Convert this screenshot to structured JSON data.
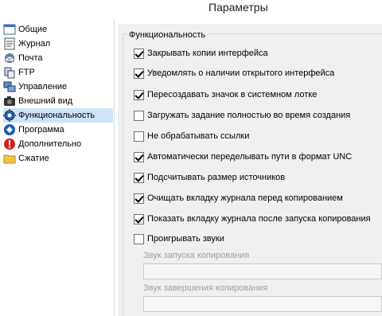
{
  "window": {
    "title": "Параметры"
  },
  "sidebar": {
    "items": [
      {
        "label": "Общие",
        "icon": "window-icon"
      },
      {
        "label": "Журнал",
        "icon": "log-icon"
      },
      {
        "label": "Почта",
        "icon": "mail-icon"
      },
      {
        "label": "FTP",
        "icon": "ftp-icon"
      },
      {
        "label": "Управление",
        "icon": "network-icon"
      },
      {
        "label": "Внешний вид",
        "icon": "camera-icon"
      },
      {
        "label": "Функциональность",
        "icon": "gear-icon",
        "selected": true
      },
      {
        "label": "Программа",
        "icon": "app-icon"
      },
      {
        "label": "Дополнительно",
        "icon": "warning-icon"
      },
      {
        "label": "Сжатие",
        "icon": "folder-icon"
      }
    ]
  },
  "panel": {
    "group_title": "Функциональность",
    "options": [
      {
        "label": "Закрывать копии интерфейса",
        "checked": true
      },
      {
        "label": "Уведомлять о наличии открытого интерфейса",
        "checked": true
      },
      {
        "label": "Пересоздавать значок в системном лотке",
        "checked": true
      },
      {
        "label": "Загружать задание полностью во время создания",
        "checked": false
      },
      {
        "label": "Не обрабатывать ссылки",
        "checked": false
      },
      {
        "label": "Автоматически переделывать пути в формат UNC",
        "checked": true
      },
      {
        "label": "Подсчитывать размер источников",
        "checked": true
      },
      {
        "label": "Очищать вкладку журнала перед копированием",
        "checked": true
      },
      {
        "label": "Показать вкладку журнала после запуска копирования",
        "checked": true
      },
      {
        "label": "Проигрывать звуки",
        "checked": false
      }
    ],
    "sound_start_label": "Звук запуска копирования",
    "sound_end_label": "Звук завершения копирования"
  },
  "colors": {
    "selection": "#cde3f7",
    "panel_bg": "#f0f0f0",
    "disabled_text": "#a0a0a0"
  }
}
